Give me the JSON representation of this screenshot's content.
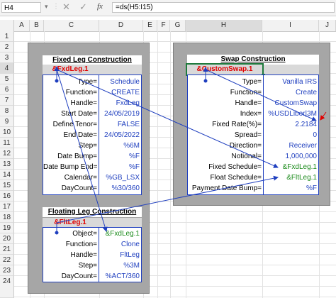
{
  "formula_bar": {
    "name_box": "H4",
    "formula": "=ds(H5:I15)",
    "fx_label": "fx",
    "cancel_glyph": "✕",
    "enter_glyph": "✓",
    "dropdown_glyph": "▾",
    "separator_glyph": "⋮"
  },
  "columns": [
    "A",
    "B",
    "C",
    "D",
    "E",
    "F",
    "G",
    "H",
    "I",
    "J"
  ],
  "rows": [
    "1",
    "2",
    "3",
    "4",
    "5",
    "6",
    "7",
    "8",
    "9",
    "10",
    "11",
    "12",
    "13",
    "14",
    "15",
    "16",
    "17",
    "18",
    "19",
    "20",
    "21",
    "22",
    "23",
    "24"
  ],
  "fixed_leg": {
    "title": "Fixed Leg Construction",
    "handle": "&FxdLeg.1",
    "rows": [
      {
        "label": "Type=",
        "value": "Schedule"
      },
      {
        "label": "Function=",
        "value": "CREATE"
      },
      {
        "label": "Handle=",
        "value": "FxdLeg"
      },
      {
        "label": "Start Date=",
        "value": "24/05/2019"
      },
      {
        "label": "Define Tenor=",
        "value": "FALSE"
      },
      {
        "label": "End Date=",
        "value": "24/05/2022"
      },
      {
        "label": "Step=",
        "value": "%6M"
      },
      {
        "label": "Date Bump=",
        "value": "%F"
      },
      {
        "label": "Date Bump End=",
        "value": "%F"
      },
      {
        "label": "Calendar=",
        "value": "%GB_LSX"
      },
      {
        "label": "DayCount=",
        "value": "%30/360"
      }
    ]
  },
  "floating_leg": {
    "title": "Floating Leg Construction",
    "handle": "&FltLeg.1",
    "rows": [
      {
        "label": "Object=",
        "value": "&FxdLeg.1"
      },
      {
        "label": "Function=",
        "value": "Clone"
      },
      {
        "label": "Handle=",
        "value": "FltLeg"
      },
      {
        "label": "Step=",
        "value": "%3M"
      },
      {
        "label": "DayCount=",
        "value": "%ACT/360"
      }
    ]
  },
  "swap": {
    "title": "Swap Construction",
    "handle": "&CustomSwap.1",
    "rows": [
      {
        "label": "Type=",
        "value": "Vanilla IRS"
      },
      {
        "label": "Function=",
        "value": "Create"
      },
      {
        "label": "Handle=",
        "value": "CustomSwap"
      },
      {
        "label": "Index=",
        "value": "%USDLibor|3M"
      },
      {
        "label": "Fixed Rate(%)=",
        "value": "2.2184"
      },
      {
        "label": "Spread=",
        "value": "0"
      },
      {
        "label": "Direction=",
        "value": "Receiver"
      },
      {
        "label": "Notional=",
        "value": "1,000,000"
      },
      {
        "label": "Fixed Schedule=",
        "value": "&FxdLeg.1"
      },
      {
        "label": "Float Schedule=",
        "value": "&FltLeg.1"
      },
      {
        "label": "Payment Date Bump=",
        "value": "%F"
      }
    ]
  },
  "colors": {
    "block_border": "#1f3fbf",
    "value_text": "#1f3fbf",
    "handle_text": "#e00000",
    "reference_text": "#1a8a1a",
    "panel_fill": "#a6a6a6",
    "selection": "#1e7a3c"
  }
}
